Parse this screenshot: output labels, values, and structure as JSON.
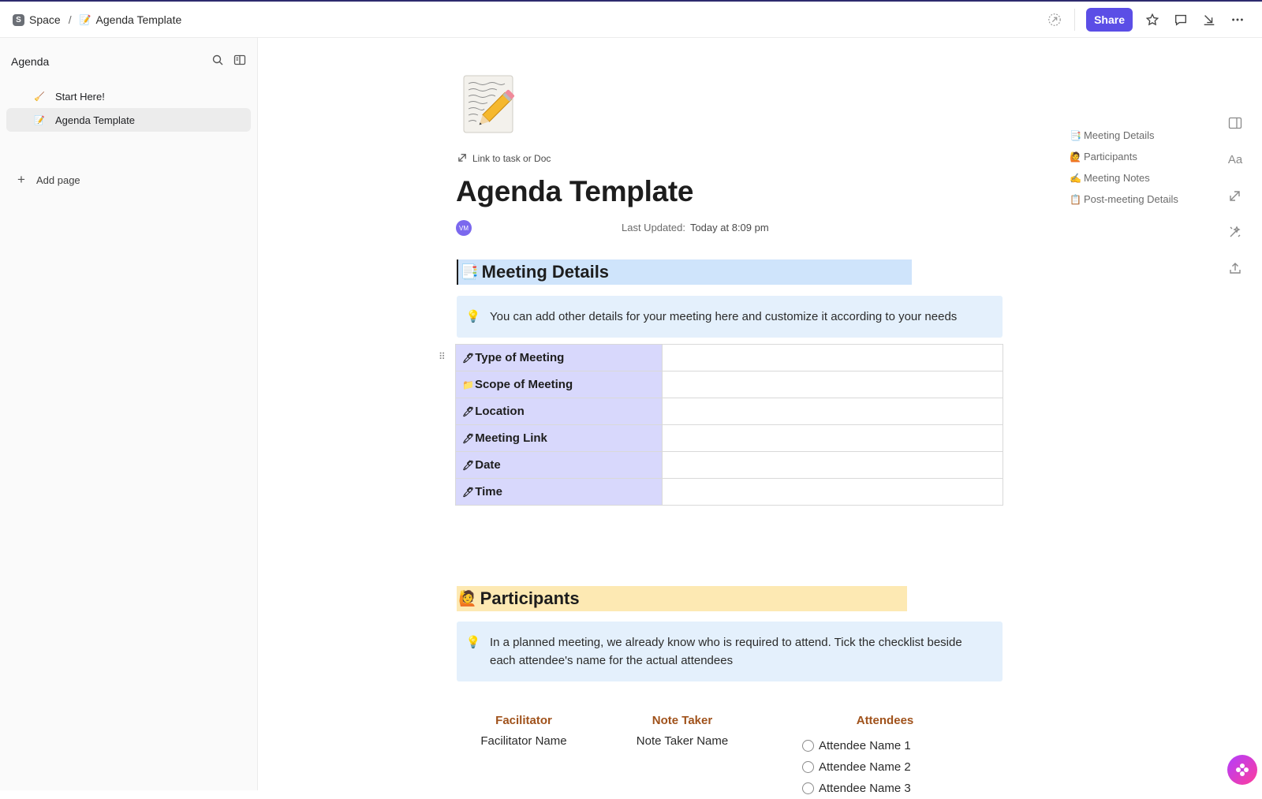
{
  "breadcrumb": {
    "space_badge": "S",
    "space": "Space",
    "separator": "/",
    "page_emoji": "📝",
    "page": "Agenda Template"
  },
  "topbar": {
    "share_label": "Share",
    "icons": [
      "ai-sparkle-icon",
      "star-icon",
      "comment-icon",
      "collapse-icon",
      "more-icon"
    ]
  },
  "sidebar": {
    "title": "Agenda",
    "items": [
      {
        "emoji": "🧹",
        "label": "Start Here!"
      },
      {
        "emoji": "📝",
        "label": "Agenda Template",
        "active": true
      }
    ],
    "add_page": "Add page"
  },
  "doc": {
    "link_task": "Link to task or Doc",
    "title": "Agenda Template",
    "avatar": "VM",
    "last_updated_label": "Last Updated:",
    "last_updated_value": "Today at 8:09 pm"
  },
  "meeting_details": {
    "emoji": "📑",
    "heading": "Meeting Details",
    "callout": "You can add other details for your meeting here and customize it according to your needs",
    "rows": [
      {
        "emoji": "🖊",
        "label": "Type of Meeting",
        "value": ""
      },
      {
        "emoji": "📁",
        "label": "Scope of Meeting",
        "value": ""
      },
      {
        "emoji": "🖊",
        "label": "Location",
        "value": ""
      },
      {
        "emoji": "🖊",
        "label": "Meeting Link",
        "value": ""
      },
      {
        "emoji": "🖊",
        "label": "Date",
        "value": ""
      },
      {
        "emoji": "🖊",
        "label": "Time",
        "value": ""
      }
    ]
  },
  "participants": {
    "emoji": "🙋",
    "heading": "Participants",
    "callout": "In a planned meeting, we already know who is required to attend. Tick the checklist beside each attendee's name for the actual attendees",
    "facilitator_header": "Facilitator",
    "facilitator_name": "Facilitator Name",
    "note_taker_header": "Note Taker",
    "note_taker_name": "Note Taker Name",
    "attendees_header": "Attendees",
    "attendees": [
      "Attendee Name 1",
      "Attendee Name 2",
      "Attendee Name 3"
    ]
  },
  "toc": [
    {
      "emoji": "📑",
      "label": "Meeting Details"
    },
    {
      "emoji": "🙋",
      "label": "Participants"
    },
    {
      "emoji": "✍️",
      "label": "Meeting Notes"
    },
    {
      "emoji": "📋",
      "label": "Post-meeting Details"
    }
  ],
  "rail": {
    "font_label": "Aa"
  },
  "colors": {
    "accent": "#5b4ee6",
    "details_band": "#cfe4fb",
    "participants_band": "#fde9b3",
    "table_key_bg": "#d8d8fc",
    "callout_bg": "#e4f0fc",
    "column_header": "#a0521b"
  }
}
